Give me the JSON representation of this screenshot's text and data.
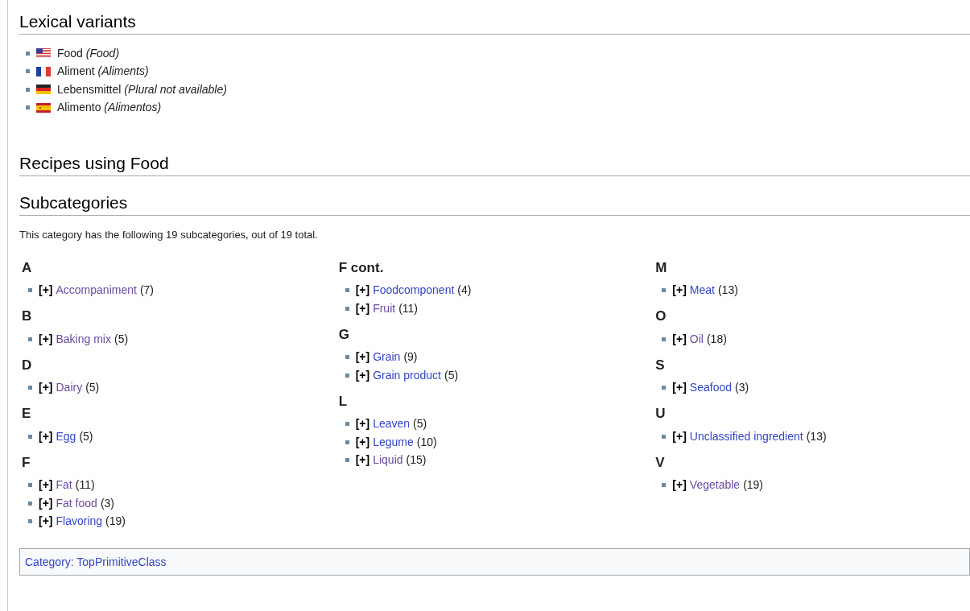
{
  "lexical_variants": {
    "heading": "Lexical variants",
    "items": [
      {
        "kind": "us",
        "label": "Food",
        "plural": "(Food)"
      },
      {
        "kind": "fr",
        "label": "Aliment",
        "plural": "(Aliments)"
      },
      {
        "kind": "de",
        "label": "Lebensmittel",
        "plural": "(Plural not available)"
      },
      {
        "kind": "es",
        "label": "Alimento",
        "plural": "(Alimentos)"
      }
    ]
  },
  "recipes": {
    "heading": "Recipes using Food"
  },
  "subcategories": {
    "heading": "Subcategories",
    "summary": "This category has the following 19 subcategories, out of 19 total.",
    "columns": [
      {
        "groups": [
          {
            "letter": "A",
            "items": [
              {
                "toggle": "[+]",
                "label": "Accompaniment",
                "count": "(7)",
                "visited": true
              }
            ]
          },
          {
            "letter": "B",
            "items": [
              {
                "toggle": "[+]",
                "label": "Baking mix",
                "count": "(5)",
                "visited": true
              }
            ]
          },
          {
            "letter": "D",
            "items": [
              {
                "toggle": "[+]",
                "label": "Dairy",
                "count": "(5)",
                "visited": true
              }
            ]
          },
          {
            "letter": "E",
            "items": [
              {
                "toggle": "[+]",
                "label": "Egg",
                "count": "(5)",
                "visited": false
              }
            ]
          },
          {
            "letter": "F",
            "items": [
              {
                "toggle": "[+]",
                "label": "Fat",
                "count": "(11)",
                "visited": true
              },
              {
                "toggle": "[+]",
                "label": "Fat food",
                "count": "(3)",
                "visited": true
              },
              {
                "toggle": "[+]",
                "label": "Flavoring",
                "count": "(19)",
                "visited": false
              }
            ]
          }
        ]
      },
      {
        "groups": [
          {
            "letter": "F cont.",
            "items": [
              {
                "toggle": "[+]",
                "label": "Foodcomponent",
                "count": "(4)",
                "visited": false
              },
              {
                "toggle": "[+]",
                "label": "Fruit",
                "count": "(11)",
                "visited": true
              }
            ]
          },
          {
            "letter": "G",
            "items": [
              {
                "toggle": "[+]",
                "label": "Grain",
                "count": "(9)",
                "visited": false
              },
              {
                "toggle": "[+]",
                "label": "Grain product",
                "count": "(5)",
                "visited": false
              }
            ]
          },
          {
            "letter": "L",
            "items": [
              {
                "toggle": "[+]",
                "label": "Leaven",
                "count": "(5)",
                "visited": false
              },
              {
                "toggle": "[+]",
                "label": "Legume",
                "count": "(10)",
                "visited": false
              },
              {
                "toggle": "[+]",
                "label": "Liquid",
                "count": "(15)",
                "visited": true
              }
            ]
          }
        ]
      },
      {
        "groups": [
          {
            "letter": "M",
            "items": [
              {
                "toggle": "[+]",
                "label": "Meat",
                "count": "(13)",
                "visited": false
              }
            ]
          },
          {
            "letter": "O",
            "items": [
              {
                "toggle": "[+]",
                "label": "Oil",
                "count": "(18)",
                "visited": true
              }
            ]
          },
          {
            "letter": "S",
            "items": [
              {
                "toggle": "[+]",
                "label": "Seafood",
                "count": "(3)",
                "visited": false
              }
            ]
          },
          {
            "letter": "U",
            "items": [
              {
                "toggle": "[+]",
                "label": "Unclassified ingredient",
                "count": "(13)",
                "visited": false
              }
            ]
          },
          {
            "letter": "V",
            "items": [
              {
                "toggle": "[+]",
                "label": "Vegetable",
                "count": "(19)",
                "visited": true
              }
            ]
          }
        ]
      }
    ]
  },
  "category_bar": {
    "link": "Category: TopPrimitiveClass"
  }
}
